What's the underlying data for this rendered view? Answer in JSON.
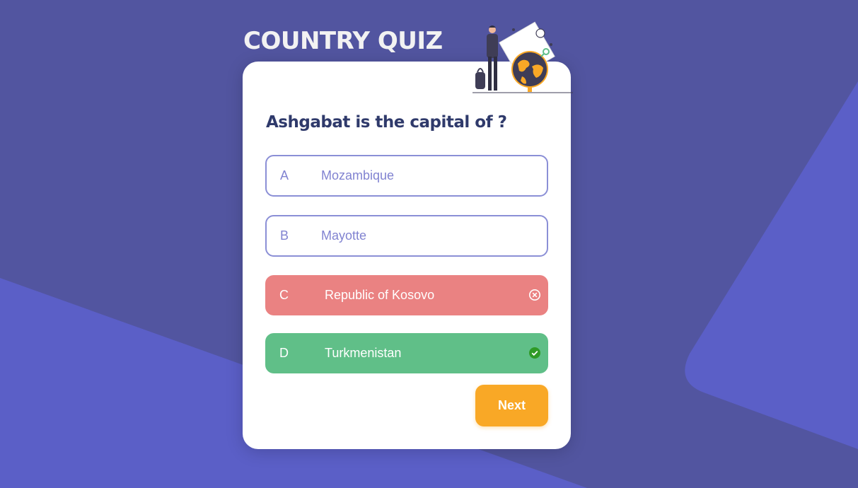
{
  "app": {
    "title": "COUNTRY QUIZ"
  },
  "quiz": {
    "question": "Ashgabat is the capital of ?",
    "options": [
      {
        "letter": "A",
        "text": "Mozambique",
        "state": "default"
      },
      {
        "letter": "B",
        "text": "Mayotte",
        "state": "default"
      },
      {
        "letter": "C",
        "text": "Republic of Kosovo",
        "state": "wrong",
        "icon": "x-circle-icon"
      },
      {
        "letter": "D",
        "text": "Turkmenistan",
        "state": "correct",
        "icon": "check-circle-icon"
      }
    ],
    "next_label": "Next"
  },
  "colors": {
    "background": "#5255a0",
    "accent_shape": "#5b5fc7",
    "option_border": "#8b8fd6",
    "wrong": "#ea8282",
    "correct": "#60bf88",
    "next_button": "#f9a826",
    "question_text": "#2f3a6b"
  }
}
